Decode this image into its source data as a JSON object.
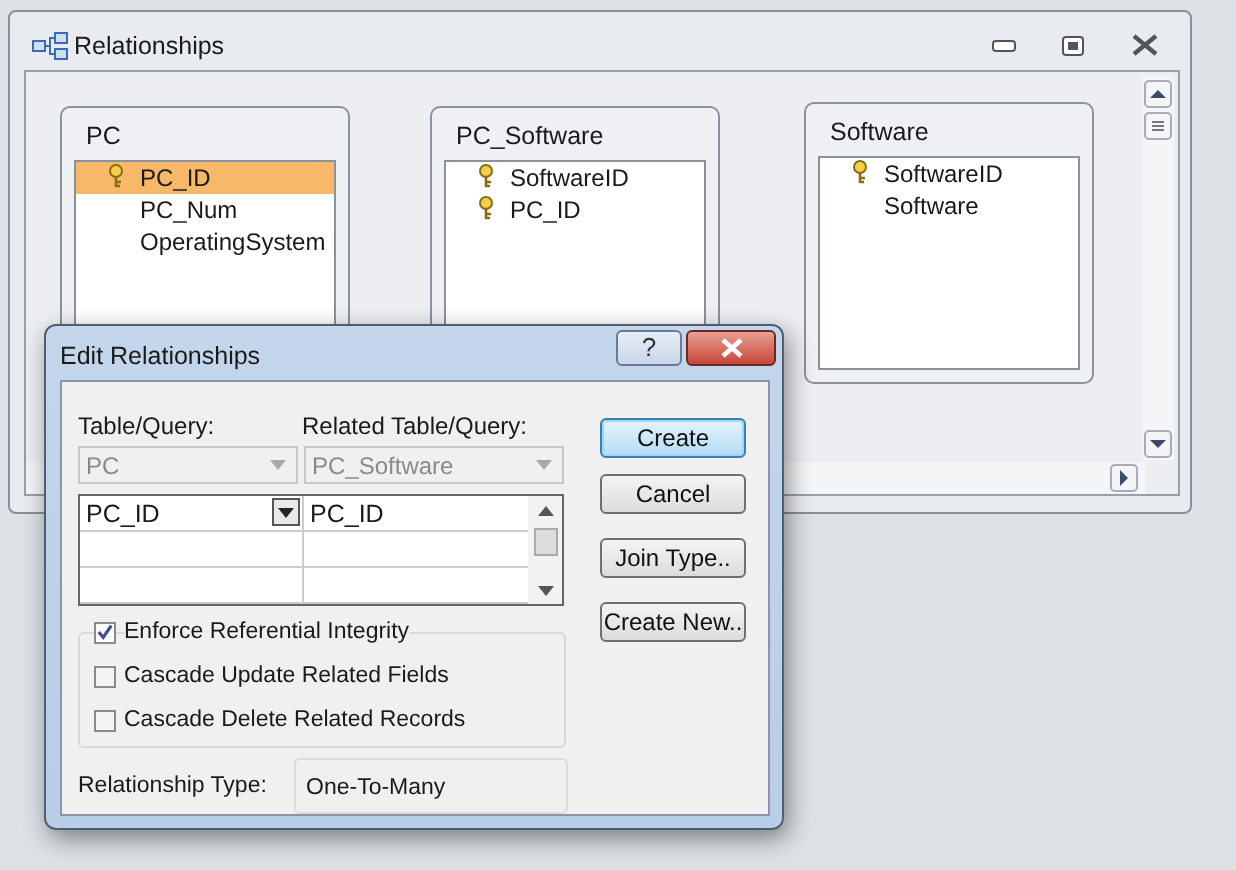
{
  "window": {
    "title": "Relationships"
  },
  "tables": [
    {
      "name": "PC",
      "fields": [
        {
          "name": "PC_ID",
          "key": true,
          "selected": true
        },
        {
          "name": "PC_Num",
          "key": false,
          "selected": false
        },
        {
          "name": "OperatingSystem",
          "key": false,
          "selected": false
        }
      ]
    },
    {
      "name": "PC_Software",
      "fields": [
        {
          "name": "SoftwareID",
          "key": true,
          "selected": false
        },
        {
          "name": "PC_ID",
          "key": true,
          "selected": false
        }
      ]
    },
    {
      "name": "Software",
      "fields": [
        {
          "name": "SoftwareID",
          "key": true,
          "selected": false
        },
        {
          "name": "Software",
          "key": false,
          "selected": false
        }
      ]
    }
  ],
  "dialog": {
    "title": "Edit Relationships",
    "help": "?",
    "table_label": "Table/Query:",
    "related_label": "Related Table/Query:",
    "table": "PC",
    "related_table": "PC_Software",
    "join_rows": [
      {
        "field": "PC_ID",
        "related_field": "PC_ID"
      }
    ],
    "options": [
      {
        "label": "Enforce Referential Integrity",
        "checked": true
      },
      {
        "label": "Cascade Update Related Fields",
        "checked": false
      },
      {
        "label": "Cascade Delete Related Records",
        "checked": false
      }
    ],
    "relationship_type_label": "Relationship Type:",
    "relationship_type": "One-To-Many",
    "buttons": [
      {
        "label": "Create",
        "default": true
      },
      {
        "label": "Cancel",
        "default": false
      },
      {
        "label": "Join Type..",
        "default": false
      },
      {
        "label": "Create New..",
        "default": false
      }
    ]
  }
}
